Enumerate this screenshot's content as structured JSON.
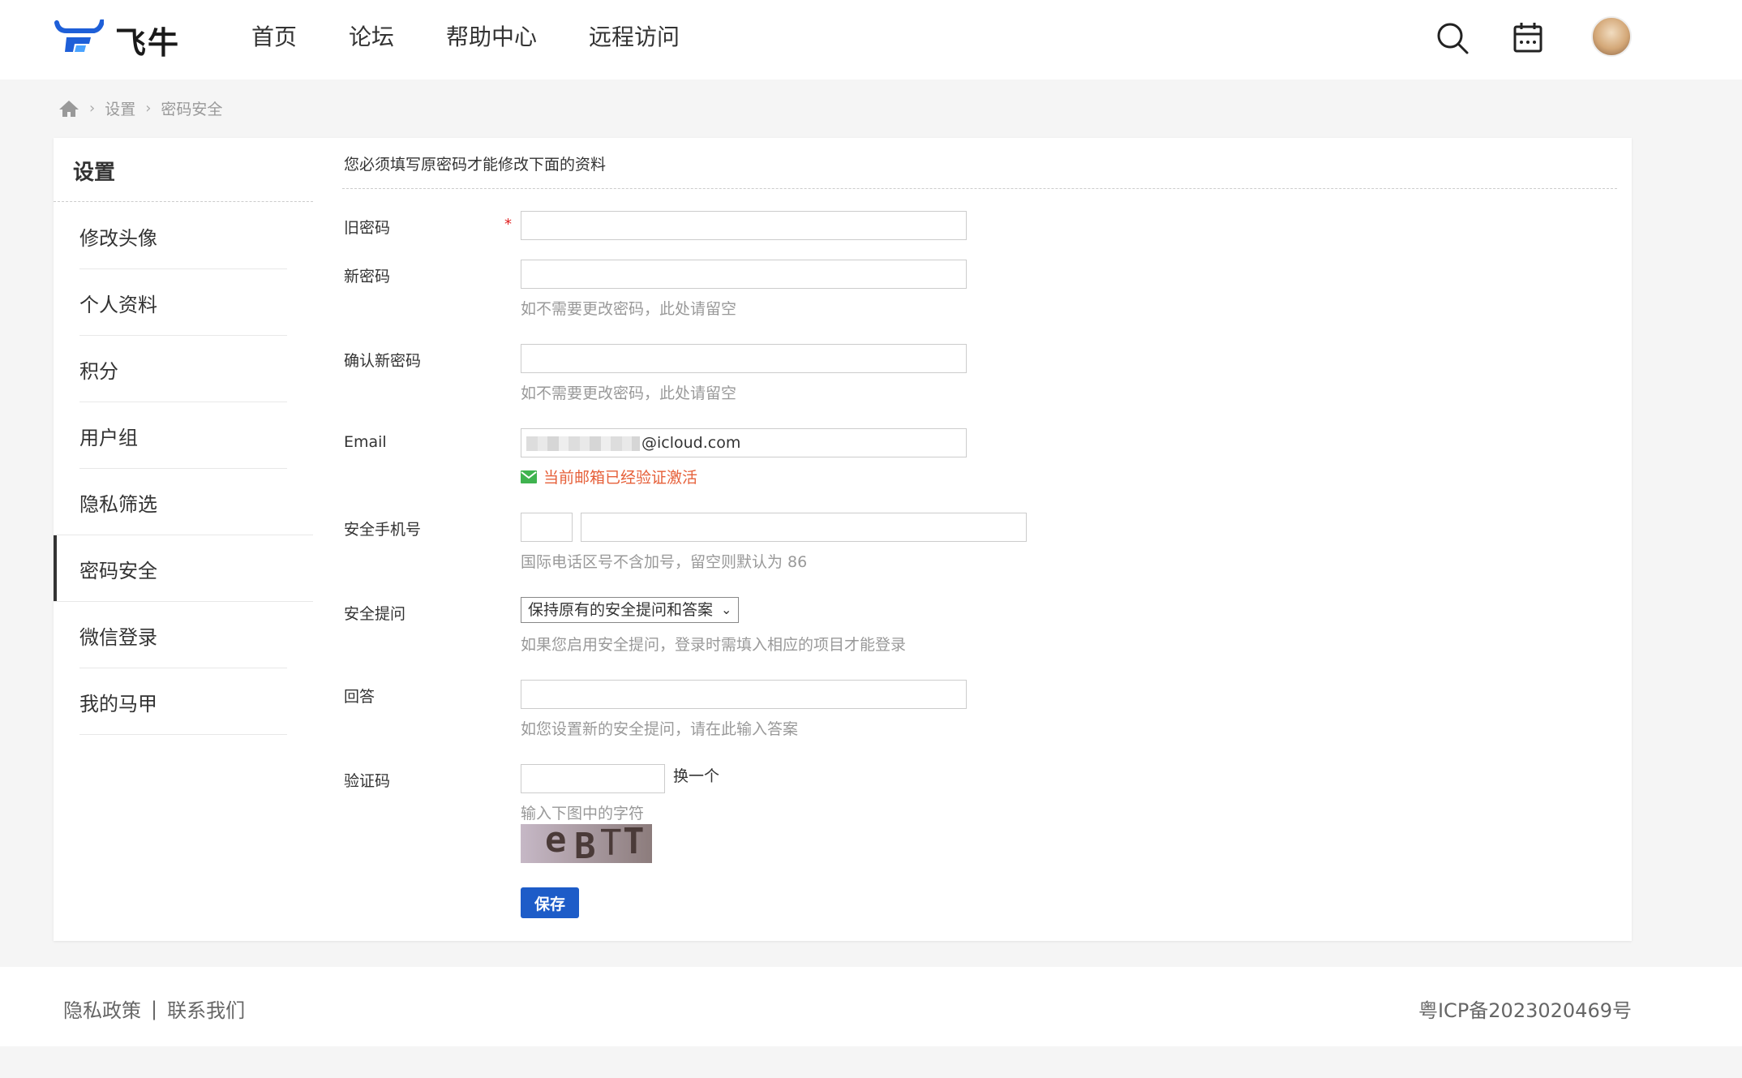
{
  "header": {
    "brand": "飞牛",
    "nav": [
      "首页",
      "论坛",
      "帮助中心",
      "远程访问"
    ]
  },
  "breadcrumb": [
    "设置",
    "密码安全"
  ],
  "sidebar": {
    "title": "设置",
    "items": [
      "修改头像",
      "个人资料",
      "积分",
      "用户组",
      "隐私筛选",
      "密码安全",
      "微信登录",
      "我的马甲"
    ],
    "active": "密码安全"
  },
  "form": {
    "title": "您必须填写原密码才能修改下面的资料",
    "old_password": {
      "label": "旧密码",
      "required_mark": "*",
      "value": ""
    },
    "new_password": {
      "label": "新密码",
      "value": "",
      "hint": "如不需要更改密码，此处请留空"
    },
    "confirm_password": {
      "label": "确认新密码",
      "value": "",
      "hint": "如不需要更改密码，此处请留空"
    },
    "email": {
      "label": "Email",
      "value_visible_part": "@icloud.com",
      "status": "当前邮箱已经验证激活"
    },
    "phone": {
      "label": "安全手机号",
      "area_code": "",
      "number": "",
      "hint": "国际电话区号不含加号，留空则默认为 86"
    },
    "security_question": {
      "label": "安全提问",
      "selected": "保持原有的安全提问和答案",
      "hint": "如果您启用安全提问，登录时需填入相应的项目才能登录"
    },
    "answer": {
      "label": "回答",
      "value": "",
      "hint": "如您设置新的安全提问，请在此输入答案"
    },
    "captcha": {
      "label": "验证码",
      "value": "",
      "change_label": "换一个",
      "hint": "输入下图中的字符",
      "image_chars": [
        "e",
        "B",
        "T",
        "T"
      ]
    },
    "save_label": "保存"
  },
  "footer": {
    "links": [
      "隐私政策",
      "联系我们"
    ],
    "divider": "|",
    "icp": "粤ICP备2023020469号"
  },
  "colors": {
    "primary_button": "#1d5cc8",
    "verified_text": "#e6603a",
    "required_mark": "#e02020",
    "brand_blue": "#1e5fd8"
  }
}
